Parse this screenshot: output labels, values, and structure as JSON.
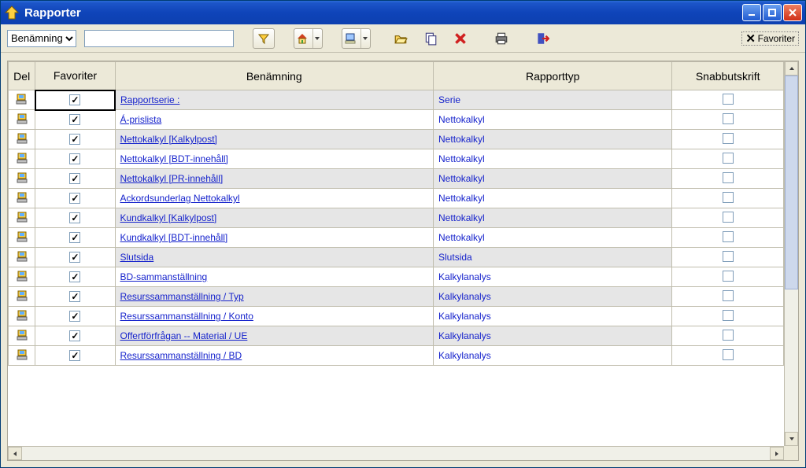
{
  "window": {
    "title": "Rapporter"
  },
  "toolbar": {
    "filter_field_options": [
      "Benämning"
    ],
    "filter_field_value": "Benämning",
    "search_value": "",
    "favoriter_label": "Favoriter",
    "favoriter_checked": true
  },
  "table": {
    "columns": {
      "del": "Del",
      "favoriter": "Favoriter",
      "benamning": "Benämning",
      "rapporttyp": "Rapporttyp",
      "snabbutskrift": "Snabbutskrift"
    },
    "rows": [
      {
        "fav": true,
        "name": "Rapportserie :",
        "type": "Serie",
        "snabb": false
      },
      {
        "fav": true,
        "name": "Á-prislista",
        "type": "Nettokalkyl",
        "snabb": false
      },
      {
        "fav": true,
        "name": "Nettokalkyl [Kalkylpost]",
        "type": "Nettokalkyl",
        "snabb": false
      },
      {
        "fav": true,
        "name": "Nettokalkyl [BDT-innehåll]",
        "type": "Nettokalkyl",
        "snabb": false
      },
      {
        "fav": true,
        "name": "Nettokalkyl [PR-innehåll]",
        "type": "Nettokalkyl",
        "snabb": false
      },
      {
        "fav": true,
        "name": "Ackordsunderlag Nettokalkyl",
        "type": "Nettokalkyl",
        "snabb": false
      },
      {
        "fav": true,
        "name": "Kundkalkyl [Kalkylpost]",
        "type": "Nettokalkyl",
        "snabb": false
      },
      {
        "fav": true,
        "name": "Kundkalkyl [BDT-innehåll]",
        "type": "Nettokalkyl",
        "snabb": false
      },
      {
        "fav": true,
        "name": "Slutsida",
        "type": "Slutsida",
        "snabb": false
      },
      {
        "fav": true,
        "name": "BD-sammanställning",
        "type": "Kalkylanalys",
        "snabb": false
      },
      {
        "fav": true,
        "name": "Resurssammanställning / Typ",
        "type": "Kalkylanalys",
        "snabb": false
      },
      {
        "fav": true,
        "name": "Resurssammanställning / Konto",
        "type": "Kalkylanalys",
        "snabb": false
      },
      {
        "fav": true,
        "name": "Offertförfrågan -- Material / UE",
        "type": "Kalkylanalys",
        "snabb": false
      },
      {
        "fav": true,
        "name": "Resurssammanställning / BD",
        "type": "Kalkylanalys",
        "snabb": false
      }
    ]
  }
}
